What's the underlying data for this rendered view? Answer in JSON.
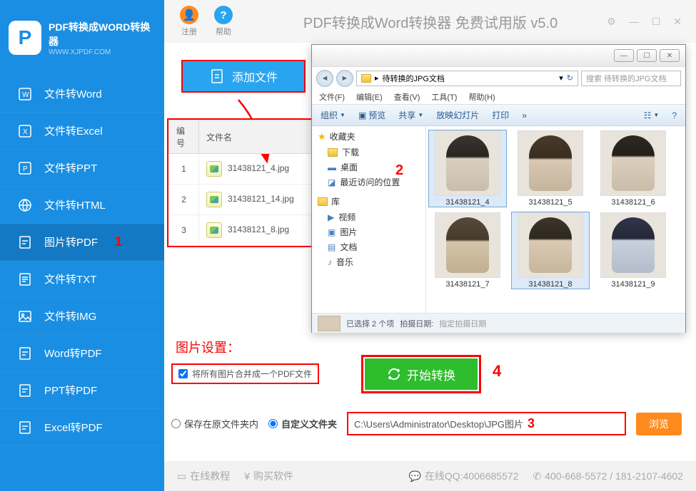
{
  "logo": {
    "title": "PDF转换成WORD转换器",
    "sub": "WWW.XJPDF.COM",
    "ico": "P"
  },
  "sidebar": {
    "items": [
      {
        "label": "文件转Word"
      },
      {
        "label": "文件转Excel"
      },
      {
        "label": "文件转PPT"
      },
      {
        "label": "文件转HTML"
      },
      {
        "label": "图片转PDF",
        "mark": "1"
      },
      {
        "label": "文件转TXT"
      },
      {
        "label": "文件转IMG"
      },
      {
        "label": "Word转PDF"
      },
      {
        "label": "PPT转PDF"
      },
      {
        "label": "Excel转PDF"
      }
    ]
  },
  "header": {
    "register": "注册",
    "help": "帮助",
    "title": "PDF转换成Word转换器 免费试用版 v5.0"
  },
  "add_btn": "添加文件",
  "table": {
    "cols": [
      "编号",
      "文件名"
    ],
    "rows": [
      {
        "no": "1",
        "name": "31438121_4.jpg"
      },
      {
        "no": "2",
        "name": "31438121_14.jpg"
      },
      {
        "no": "3",
        "name": "31438121_8.jpg"
      }
    ]
  },
  "settings_label": "图片设置：",
  "merge_label": "将所有图片合并成一个PDF文件",
  "start_btn": "开始转换",
  "start_mark": "4",
  "output": {
    "opt1": "保存在原文件夹内",
    "opt2": "自定义文件夹",
    "path": "C:\\Users\\Administrator\\Desktop\\JPG图片",
    "path_mark": "3",
    "browse": "浏览"
  },
  "footer": {
    "tutorial": "在线教程",
    "buy": "购买软件",
    "qq": "在线QQ:4006685572",
    "phone": "400-668-5572 / 181-2107-4602"
  },
  "dialog": {
    "crumb": "待转换的JPG文档",
    "search_ph": "搜索 待转换的JPG文档",
    "menu": [
      "文件(F)",
      "编辑(E)",
      "查看(V)",
      "工具(T)",
      "帮助(H)"
    ],
    "toolbar": {
      "org": "组织",
      "preview": "预览",
      "share": "共享",
      "slide": "放映幻灯片",
      "print": "打印"
    },
    "tree": {
      "fav": "收藏夹",
      "dl": "下载",
      "desk": "桌面",
      "recent": "最近访问的位置",
      "lib": "库",
      "video": "视频",
      "pic": "图片",
      "doc": "文档",
      "music": "音乐",
      "mark": "2"
    },
    "thumbs": [
      {
        "label": "31438121_4",
        "sel": true
      },
      {
        "label": "31438121_5"
      },
      {
        "label": "31438121_6"
      },
      {
        "label": "31438121_7"
      },
      {
        "label": "31438121_8",
        "sel": true
      },
      {
        "label": "31438121_9"
      }
    ],
    "status": {
      "count": "已选择 2 个项",
      "date_lbl": "拍摄日期:",
      "date_val": "指定拍摄日期"
    }
  }
}
